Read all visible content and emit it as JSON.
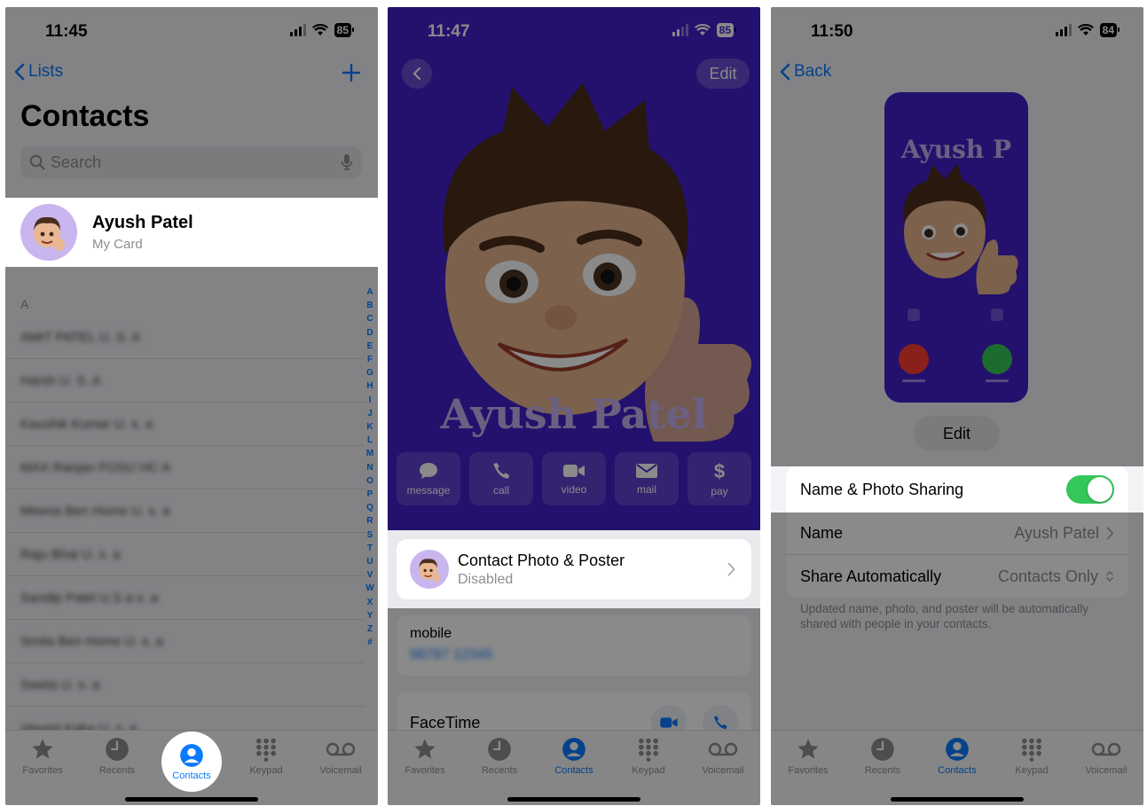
{
  "screen1": {
    "status": {
      "time": "11:45",
      "battery": "85"
    },
    "nav": {
      "back_label": "Lists",
      "add_label": "+"
    },
    "title": "Contacts",
    "search": {
      "placeholder": "Search"
    },
    "my_card": {
      "name": "Ayush Patel",
      "subtitle": "My Card"
    },
    "section_letter": "A",
    "contacts": [
      "AMIT PATEL U. S. A",
      "Harsh U. S. A",
      "Kaushik Kumar U. s. a",
      "MAX Ranjan FOSU HC A",
      "Meena Ben Home U. s. a",
      "Raju Bhai U. s. a",
      "Sandip Patel U.S a s. a",
      "Smita Ben Home U. s. a",
      "Sweta U. s. a",
      "Vasant Kaka U. s. a"
    ],
    "index": [
      "A",
      "B",
      "C",
      "D",
      "E",
      "F",
      "G",
      "H",
      "I",
      "J",
      "K",
      "L",
      "M",
      "N",
      "O",
      "P",
      "Q",
      "R",
      "S",
      "T",
      "U",
      "V",
      "W",
      "X",
      "Y",
      "Z",
      "#"
    ]
  },
  "screen2": {
    "status": {
      "time": "11:47",
      "battery": "85"
    },
    "edit_label": "Edit",
    "poster_name": "Ayush Patel",
    "actions": [
      {
        "icon": "message-icon",
        "label": "message"
      },
      {
        "icon": "call-icon",
        "label": "call"
      },
      {
        "icon": "video-icon",
        "label": "video"
      },
      {
        "icon": "mail-icon",
        "label": "mail"
      },
      {
        "icon": "pay-icon",
        "label": "pay"
      }
    ],
    "poster_card": {
      "title": "Contact Photo & Poster",
      "subtitle": "Disabled"
    },
    "mobile": {
      "label": "mobile",
      "value": "98787 12345"
    },
    "facetime": {
      "label": "FaceTime"
    }
  },
  "screen3": {
    "status": {
      "time": "11:50",
      "battery": "84"
    },
    "back_label": "Back",
    "preview_name": "Ayush P",
    "edit_label": "Edit",
    "sharing_label": "Name & Photo Sharing",
    "sharing_on": true,
    "name_row": {
      "label": "Name",
      "value": "Ayush Patel"
    },
    "share_row": {
      "label": "Share Automatically",
      "value": "Contacts Only"
    },
    "footer": "Updated name, photo, and poster will be automatically shared with people in your contacts."
  },
  "tabbar": {
    "tabs": [
      {
        "icon": "star-icon",
        "label": "Favorites"
      },
      {
        "icon": "clock-icon",
        "label": "Recents"
      },
      {
        "icon": "person-circle-icon",
        "label": "Contacts"
      },
      {
        "icon": "keypad-icon",
        "label": "Keypad"
      },
      {
        "icon": "voicemail-icon",
        "label": "Voicemail"
      }
    ]
  },
  "colors": {
    "accent": "#0a7aff",
    "poster_bg": "#4321c9",
    "toggle_on": "#34c759",
    "poster_text": "#c5b2f0"
  }
}
